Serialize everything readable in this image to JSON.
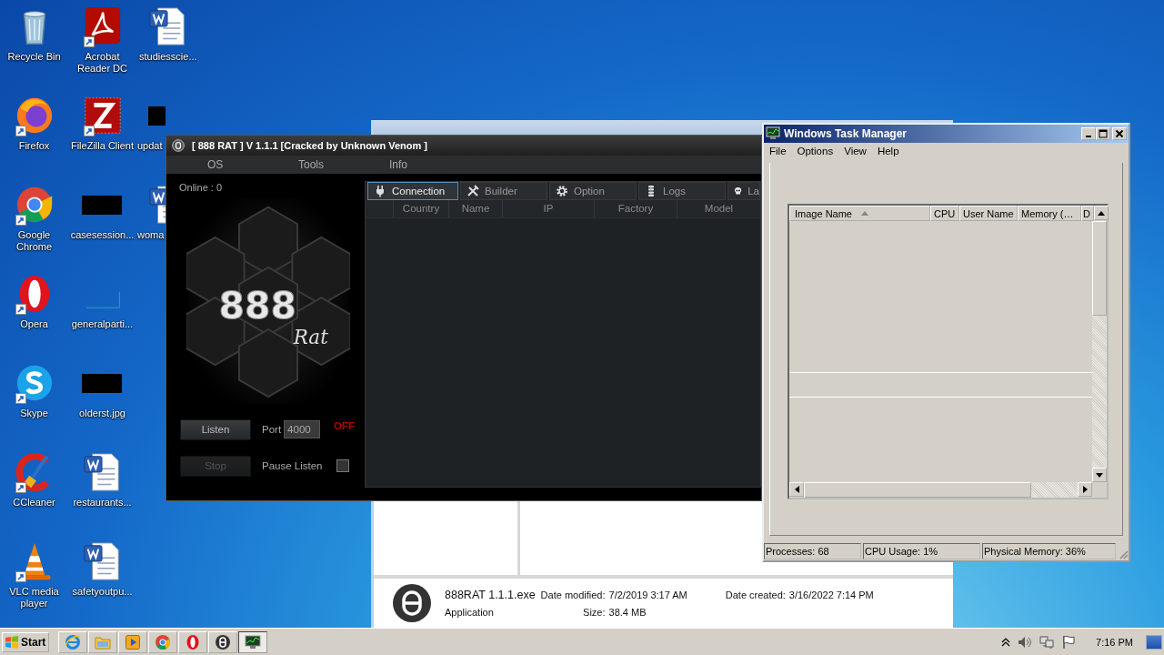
{
  "desktop": {
    "columns": [
      [
        {
          "label": "Recycle Bin",
          "kind": "recycle",
          "shortcut": false
        },
        {
          "label": "Firefox",
          "kind": "firefox",
          "shortcut": true
        },
        {
          "label": "Google Chrome",
          "kind": "chrome",
          "shortcut": true
        },
        {
          "label": "Opera",
          "kind": "opera",
          "shortcut": true
        },
        {
          "label": "Skype",
          "kind": "skype",
          "shortcut": true
        },
        {
          "label": "CCleaner",
          "kind": "ccleaner",
          "shortcut": true
        },
        {
          "label": "VLC media player",
          "kind": "vlc",
          "shortcut": true
        }
      ],
      [
        {
          "label": "Acrobat Reader DC",
          "kind": "acrobat",
          "shortcut": true
        },
        {
          "label": "FileZilla Client",
          "kind": "filezilla",
          "shortcut": true
        },
        {
          "label": "casesession...",
          "kind": "redacted",
          "shortcut": false
        },
        {
          "label": "generalparti...",
          "kind": "blank",
          "shortcut": false
        },
        {
          "label": "olderst.jpg",
          "kind": "redacted",
          "shortcut": false
        },
        {
          "label": "restaurants...",
          "kind": "word",
          "shortcut": false
        },
        {
          "label": "safetyoutpu...",
          "kind": "word",
          "shortcut": false
        }
      ],
      [
        {
          "label": "studiesscie...",
          "kind": "word",
          "shortcut": false
        },
        {
          "label": "updat",
          "kind": "redacted",
          "shortcut": false
        },
        {
          "label": "woma",
          "kind": "word",
          "shortcut": false
        }
      ]
    ]
  },
  "explorer": {
    "file": {
      "name": "888RAT 1.1.1.exe",
      "type": "Application",
      "details": [
        {
          "label": "Date modified:",
          "value": "7/2/2019 3:17 AM"
        },
        {
          "label": "Size:",
          "value": "38.4 MB"
        },
        {
          "label": "Date created:",
          "value": "3/16/2022 7:14 PM"
        }
      ]
    }
  },
  "rat": {
    "title": "[ 888 RAT ] V 1.1.1 [Cracked by Unknown Venom ]",
    "menu": [
      "OS",
      "Tools",
      "Info"
    ],
    "online": "Online : 0",
    "logo": {
      "number": "888",
      "script": "Rat"
    },
    "listen_button": "Listen",
    "port_label": "Port",
    "port": "4000",
    "status": "OFF",
    "stop_button": {
      "label": "Stop",
      "disabled": true
    },
    "pause": {
      "label": "Pause Listen",
      "checked": false
    },
    "tabs": [
      {
        "label": "Connection",
        "selected": true
      },
      {
        "label": "Builder",
        "selected": false
      },
      {
        "label": "Option",
        "selected": false
      },
      {
        "label": "Logs",
        "selected": false
      },
      {
        "label": "La",
        "selected": false
      }
    ],
    "columns": [
      "Country",
      "Name",
      "IP",
      "Factory",
      "Model"
    ]
  },
  "taskmgr": {
    "title": "Windows Task Manager",
    "menu": [
      "File",
      "Options",
      "View",
      "Help"
    ],
    "columns": [
      {
        "label": "Image Name",
        "sorted": true
      },
      {
        "label": "CPU",
        "sorted": false
      },
      {
        "label": "User Name",
        "sorted": false
      },
      {
        "label": "Memory (…",
        "sorted": false
      },
      {
        "label": "D",
        "sorted": false
      }
    ],
    "status": [
      "Processes: 68",
      "CPU Usage: 1%",
      "Physical Memory: 36%"
    ]
  },
  "taskbar": {
    "start": "Start",
    "apps": [
      {
        "kind": "ie",
        "selected": false
      },
      {
        "kind": "folder",
        "selected": false
      },
      {
        "kind": "media",
        "selected": false
      },
      {
        "kind": "chrome",
        "selected": false
      },
      {
        "kind": "opera",
        "selected": false
      },
      {
        "kind": "rat",
        "selected": false
      },
      {
        "kind": "taskmgr",
        "selected": true
      }
    ],
    "time": "7:16 PM"
  }
}
